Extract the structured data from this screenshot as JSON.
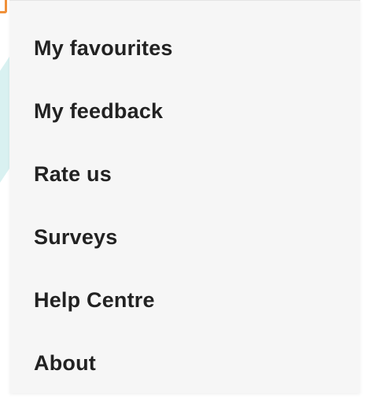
{
  "colors": {
    "menu_background": "#f6f6f6",
    "text": "#222222",
    "accent": "#f0913a",
    "background_shape": "#d9f1f1"
  },
  "menu": {
    "items": [
      {
        "label": "My favourites"
      },
      {
        "label": "My feedback"
      },
      {
        "label": "Rate us"
      },
      {
        "label": "Surveys"
      },
      {
        "label": "Help Centre"
      },
      {
        "label": "About"
      }
    ]
  }
}
